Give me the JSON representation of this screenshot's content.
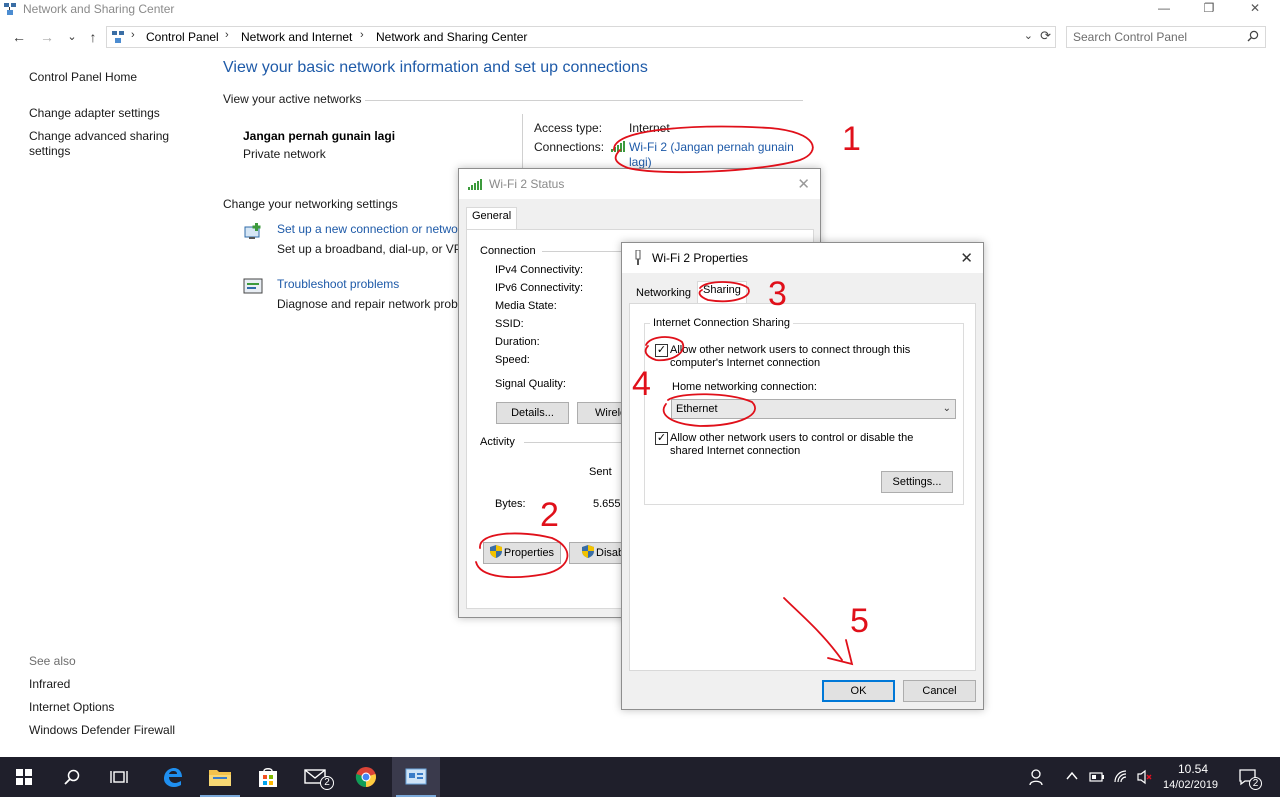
{
  "window": {
    "title": "Network and Sharing Center",
    "minimize_glyph": "—",
    "restore_glyph": "❐",
    "close_glyph": "✕"
  },
  "nav": {
    "back_glyph": "←",
    "forward_glyph": "→",
    "recent_glyph": "⌄",
    "up_glyph": "↑",
    "breadcrumbs": [
      "Control Panel",
      "Network and Internet",
      "Network and Sharing Center"
    ],
    "sep_glyph": "›",
    "dropdown_glyph": "⌄",
    "refresh_glyph": "⟳"
  },
  "search": {
    "placeholder": "Search Control Panel"
  },
  "sidebar": {
    "home": "Control Panel Home",
    "items": [
      "Change adapter settings",
      "Change advanced sharing settings"
    ],
    "see_also_header": "See also",
    "see_also": [
      "Infrared",
      "Internet Options",
      "Windows Defender Firewall"
    ]
  },
  "main": {
    "title": "View your basic network information and set up connections",
    "active_networks_header": "View your active networks",
    "network_name": "Jangan pernah gunain lagi",
    "network_category": "Private network",
    "access_type_label": "Access type:",
    "access_type_value": "Internet",
    "connections_label": "Connections:",
    "connection_line1": "Wi-Fi 2 (Jangan pernah gunain",
    "connection_line2": "lagi)",
    "change_settings_header": "Change your networking settings",
    "tasks": [
      {
        "link": "Set up a new connection or networ",
        "desc": "Set up a broadband, dial-up, or VP"
      },
      {
        "link": "Troubleshoot problems",
        "desc": "Diagnose and repair network probl"
      }
    ]
  },
  "status_dialog": {
    "title": "Wi-Fi 2 Status",
    "tab": "General",
    "connection_header": "Connection",
    "rows": [
      "IPv4 Connectivity:",
      "IPv6 Connectivity:",
      "Media State:",
      "SSID:",
      "Duration:",
      "Speed:"
    ],
    "signal_quality": "Signal Quality:",
    "details_button": "Details...",
    "wireless_button": "Wirele",
    "activity_header": "Activity",
    "sent_label": "Sent",
    "bytes_label": "Bytes:",
    "bytes_sent": "5.655",
    "properties_button": "Properties",
    "disable_button": "Disab"
  },
  "props_dialog": {
    "title": "Wi-Fi 2 Properties",
    "tabs": [
      "Networking",
      "Sharing"
    ],
    "group_title": "Internet Connection Sharing",
    "allow_connect_line1": "Allow other network users to connect through this",
    "allow_connect_line2": "computer's Internet connection",
    "allow_connect_checked": true,
    "home_network_label": "Home networking connection:",
    "home_network_value": "Ethernet",
    "allow_control_line1": "Allow other network users to control or disable the",
    "allow_control_line2": "shared Internet connection",
    "allow_control_checked": true,
    "settings_button": "Settings...",
    "ok_button": "OK",
    "cancel_button": "Cancel",
    "check_glyph": "✓",
    "close_glyph": "✕"
  },
  "annotations": [
    "1",
    "2",
    "3",
    "4",
    "5"
  ],
  "taskbar": {
    "mail_badge": "2",
    "notification_badge": "2",
    "time": "10.54",
    "date": "14/02/2019"
  },
  "colors": {
    "link": "#1e5aa8",
    "annotation": "#e0101a",
    "taskbar": "#1f1f2b",
    "default_button_border": "#0078d7"
  }
}
